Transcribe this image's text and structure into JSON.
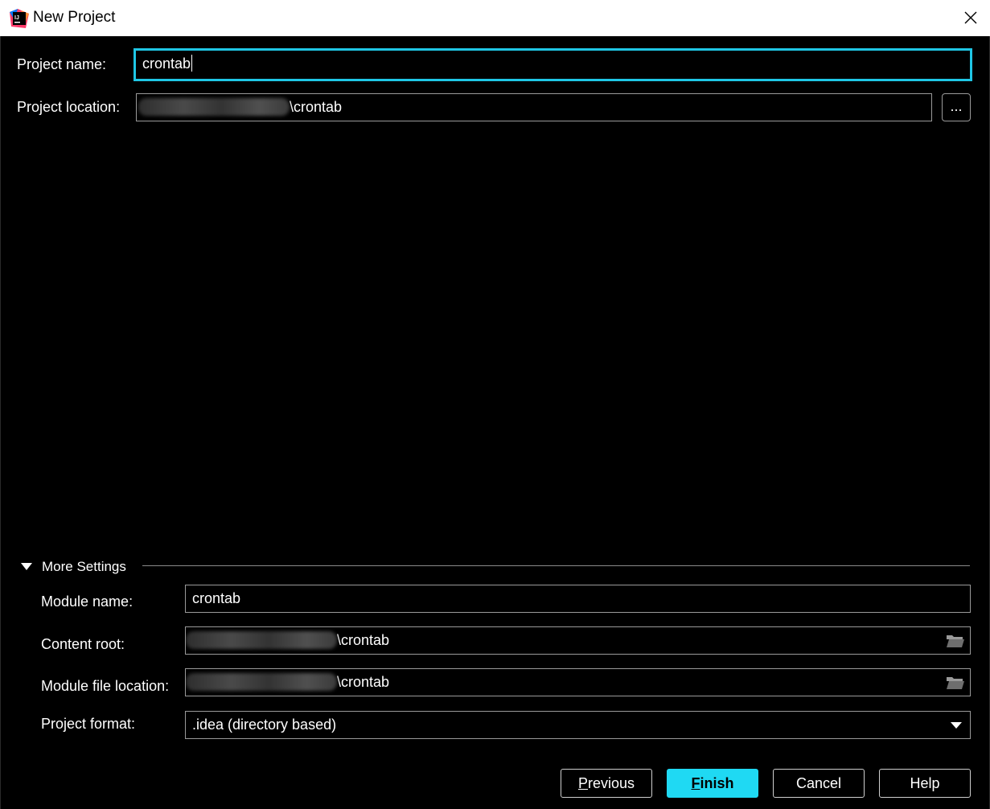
{
  "window": {
    "title": "New Project",
    "app_icon_text": "IJ"
  },
  "project": {
    "name_label": "Project name:",
    "name_value": "crontab",
    "location_label": "Project location:",
    "location_value": "\\crontab",
    "browse_label": "..."
  },
  "more_settings": {
    "title": "More Settings",
    "module_name_label": "Module name:",
    "module_name_value": "crontab",
    "content_root_label": "Content root:",
    "content_root_value": "\\crontab",
    "module_file_label": "Module file location:",
    "module_file_value": "\\crontab",
    "format_label": "Project format:",
    "format_value": ".idea (directory based)"
  },
  "buttons": {
    "previous_mnemonic": "P",
    "previous_rest": "revious",
    "finish_mnemonic": "F",
    "finish_rest": "inish",
    "cancel": "Cancel",
    "help": "Help"
  },
  "colors": {
    "focus": "#1fc6e5",
    "primary": "#1fd9f3",
    "background": "#000000"
  }
}
